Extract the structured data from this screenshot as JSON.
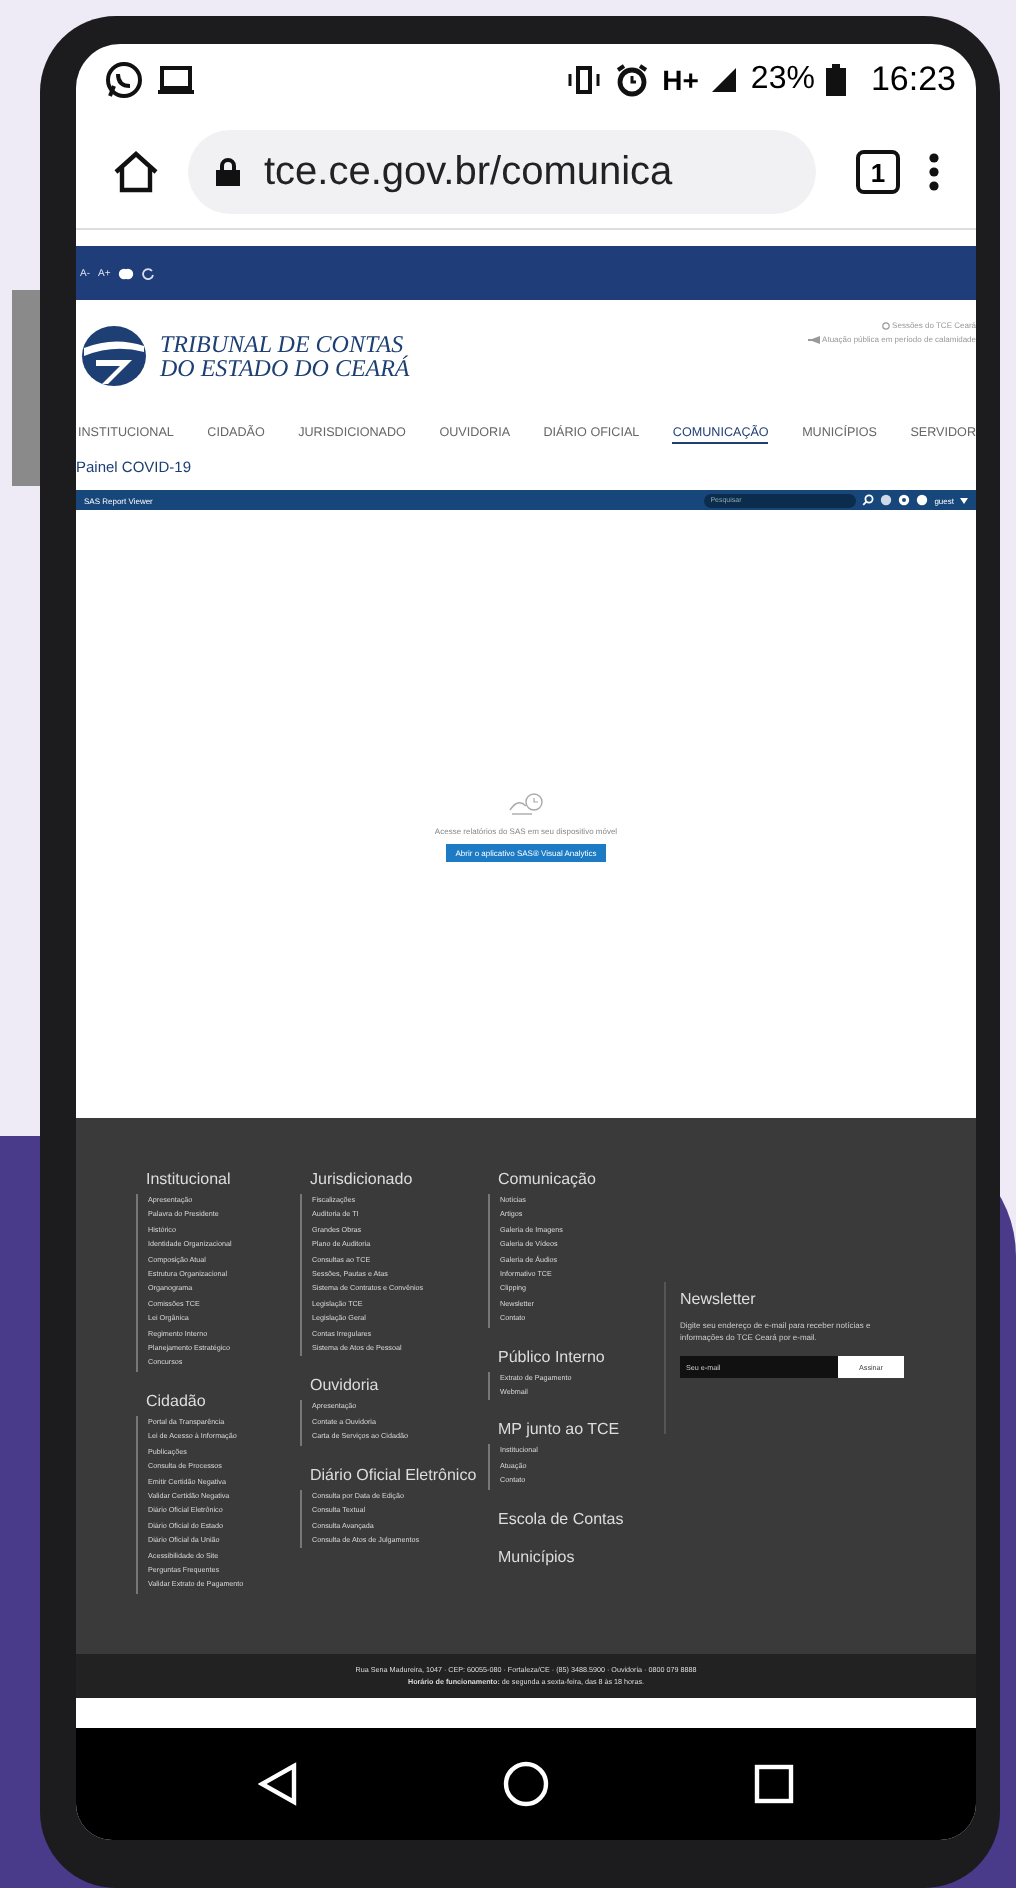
{
  "status_bar": {
    "network": "H+",
    "battery": "23%",
    "time": "16:23"
  },
  "browser": {
    "url": "tce.ce.gov.br/comunica",
    "tab_count": "1"
  },
  "site": {
    "accessibility": [
      "A-",
      "A+"
    ],
    "top_links": [
      "Sessões do TCE Ceará",
      "Atuação pública em período de calamidade"
    ],
    "logo": [
      "TRIBUNAL DE CONTAS",
      "DO ESTADO DO CEARÁ"
    ],
    "nav": [
      {
        "label": "INSTITUCIONAL",
        "selected": false
      },
      {
        "label": "CIDADÃO",
        "selected": false
      },
      {
        "label": "JURISDICIONADO",
        "selected": false
      },
      {
        "label": "OUVIDORIA",
        "selected": false
      },
      {
        "label": "DIÁRIO OFICIAL",
        "selected": false
      },
      {
        "label": "COMUNICAÇÃO",
        "selected": true
      },
      {
        "label": "MUNICÍPIOS",
        "selected": false
      },
      {
        "label": "SERVIDOR",
        "selected": false
      }
    ],
    "page_title": "Painel COVID-19",
    "report_viewer": {
      "title": "SAS Report Viewer",
      "search_placeholder": "Pesquisar",
      "user": "guest",
      "message": "Acesse relatórios do SAS em seu dispositivo móvel",
      "button": "Abrir o aplicativo SAS® Visual Analytics"
    },
    "footer": {
      "columns": [
        [
          {
            "title": "Institucional",
            "items": [
              "Apresentação",
              "Palavra do Presidente",
              "Histórico",
              "Identidade Organizacional",
              "Composição Atual",
              "Estrutura Organizacional",
              "Organograma",
              "Comissões TCE",
              "Lei Orgânica",
              "Regimento Interno",
              "Planejamento Estratégico",
              "Concursos"
            ]
          },
          {
            "title": "Cidadão",
            "items": [
              "Portal da Transparência",
              "Lei de Acesso à Informação",
              "Publicações",
              "Consulta de Processos",
              "Emitir Certidão Negativa",
              "Validar Certidão Negativa",
              "Diário Oficial Eletrônico",
              "Diário Oficial do Estado",
              "Diário Oficial da União",
              "Acessibilidade do Site",
              "Perguntas Frequentes",
              "Validar Extrato de Pagamento"
            ]
          }
        ],
        [
          {
            "title": "Jurisdicionado",
            "items": [
              "Fiscalizações",
              "Auditoria de TI",
              "Grandes Obras",
              "Plano de Auditoria",
              "Consultas ao TCE",
              "Sessões, Pautas e Atas",
              "Sistema de Contratos e Convênios",
              "Legislação TCE",
              "Legislação Geral",
              "Contas Irregulares",
              "Sistema de Atos de Pessoal"
            ]
          },
          {
            "title": "Ouvidoria",
            "items": [
              "Apresentação",
              "Contate a Ouvidoria",
              "Carta de Serviços ao Cidadão"
            ]
          },
          {
            "title": "Diário Oficial Eletrônico",
            "items": [
              "Consulta por Data de Edição",
              "Consulta Textual",
              "Consulta Avançada",
              "Consulta de Atos de Julgamentos"
            ]
          }
        ],
        [
          {
            "title": "Comunicação",
            "items": [
              "Notícias",
              "Artigos",
              "Galeria de Imagens",
              "Galeria de Vídeos",
              "Galeria de Áudios",
              "Informativo TCE",
              "Clipping",
              "Newsletter",
              "Contato"
            ]
          },
          {
            "title": "Público Interno",
            "items": [
              "Extrato de Pagamento",
              "Webmail"
            ]
          },
          {
            "title": "MP junto ao TCE",
            "items": [
              "Institucional",
              "Atuação",
              "Contato"
            ]
          },
          {
            "title": "Escola de Contas"
          },
          {
            "title": "Municípios"
          }
        ]
      ],
      "newsletter": {
        "title": "Newsletter",
        "text": "Digite seu endereço de e-mail para receber notícias e informações do TCE Ceará por e-mail.",
        "placeholder": "Seu e-mail",
        "button": "Assinar"
      },
      "address": "Rua Sena Madureira, 1047 · CEP: 60055-080 · Fortaleza/CE · (85) 3488.5900 · Ouvidoria · 0800 079 8888",
      "hours": "**Horário de funcionamento:** de segunda a sexta-feira, das 8 às 18 horas."
    }
  }
}
